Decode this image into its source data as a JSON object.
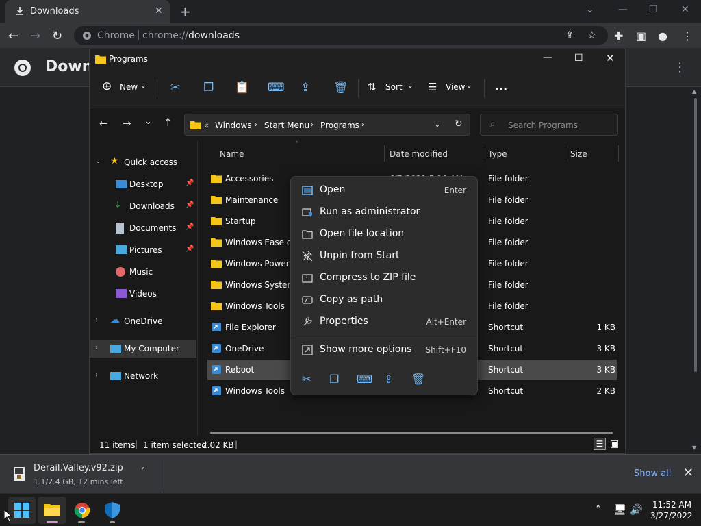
{
  "chrome": {
    "tab_title": "Downloads",
    "site_label": "Chrome",
    "url_scheme": "chrome://",
    "url_path": "downloads",
    "page_title": "Downloads"
  },
  "explorer": {
    "window_title": "Programs",
    "toolbar": {
      "new_label": "New",
      "sort_label": "Sort",
      "view_label": "View",
      "more_label": "..."
    },
    "address": {
      "prefix": "«",
      "crumbs": [
        "Windows",
        "Start Menu",
        "Programs"
      ]
    },
    "search_placeholder": "Search Programs",
    "nav": {
      "quick_access": "Quick access",
      "desktop": "Desktop",
      "downloads": "Downloads",
      "documents": "Documents",
      "pictures": "Pictures",
      "music": "Music",
      "videos": "Videos",
      "onedrive": "OneDrive",
      "my_computer": "My Computer",
      "network": "Network"
    },
    "columns": {
      "name": "Name",
      "date": "Date modified",
      "type": "Type",
      "size": "Size"
    },
    "rows": [
      {
        "name": "Accessories",
        "date": "6/5/2021 5:10 AM",
        "type": "File folder",
        "size": ""
      },
      {
        "name": "Maintenance",
        "date": "",
        "type": "File folder",
        "size": ""
      },
      {
        "name": "Startup",
        "date": "",
        "type": "File folder",
        "size": ""
      },
      {
        "name": "Windows Ease of A",
        "date": "",
        "type": "File folder",
        "size": ""
      },
      {
        "name": "Windows PowerSh",
        "date": "",
        "type": "File folder",
        "size": ""
      },
      {
        "name": "Windows System",
        "date": "",
        "type": "File folder",
        "size": ""
      },
      {
        "name": "Windows Tools",
        "date": "",
        "type": "File folder",
        "size": ""
      },
      {
        "name": "File Explorer",
        "date": "",
        "type": "Shortcut",
        "size": "1 KB"
      },
      {
        "name": "OneDrive",
        "date": "",
        "type": "Shortcut",
        "size": "3 KB"
      },
      {
        "name": "Reboot",
        "date": "",
        "type": "Shortcut",
        "size": "3 KB"
      },
      {
        "name": "Windows Tools",
        "date": "",
        "type": "Shortcut",
        "size": "2 KB"
      }
    ],
    "status": {
      "items": "11 items",
      "sep": "|",
      "selected": "1 item selected",
      "size": "2.02 KB",
      "sep2": "|"
    }
  },
  "context_menu": {
    "items": [
      {
        "label": "Open",
        "accel": "Enter"
      },
      {
        "label": "Run as administrator",
        "accel": ""
      },
      {
        "label": "Open file location",
        "accel": ""
      },
      {
        "label": "Unpin from Start",
        "accel": ""
      },
      {
        "label": "Compress to ZIP file",
        "accel": ""
      },
      {
        "label": "Copy as path",
        "accel": ""
      },
      {
        "label": "Properties",
        "accel": "Alt+Enter"
      },
      {
        "label": "Show more options",
        "accel": "Shift+F10"
      }
    ]
  },
  "download_shelf": {
    "filename": "Derail.Valley.v92.zip",
    "meta": "1.1/2.4 GB, 12 mins left",
    "show_all": "Show all"
  },
  "taskbar": {
    "time": "11:52 AM",
    "date": "3/27/2022"
  },
  "colors": {
    "accent": "#7ab9f4",
    "folder": "#f5c518",
    "link": "#8ab4f8"
  }
}
